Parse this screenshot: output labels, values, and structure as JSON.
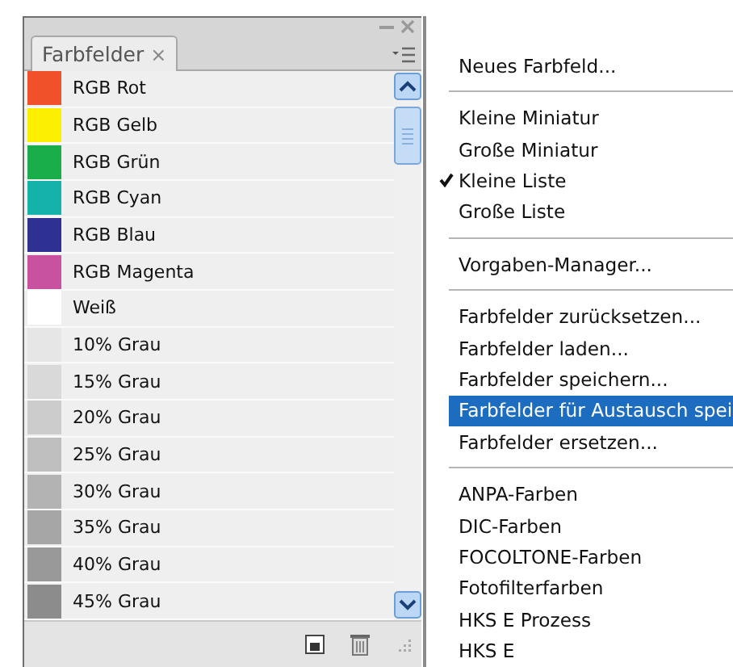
{
  "panel": {
    "tab": {
      "label": "Farbfelder",
      "close": "×"
    },
    "swatches": [
      {
        "name": "RGB Rot",
        "color": "#f0502a"
      },
      {
        "name": "RGB Gelb",
        "color": "#fdef00"
      },
      {
        "name": "RGB Grün",
        "color": "#1aae4a"
      },
      {
        "name": "RGB Cyan",
        "color": "#14b2a8"
      },
      {
        "name": "RGB Blau",
        "color": "#2e3192"
      },
      {
        "name": "RGB Magenta",
        "color": "#c952a0"
      },
      {
        "name": "Weiß",
        "color": "#ffffff"
      },
      {
        "name": "10% Grau",
        "color": "#e6e6e6"
      },
      {
        "name": "15% Grau",
        "color": "#d9d9d9"
      },
      {
        "name": "20% Grau",
        "color": "#cccccc"
      },
      {
        "name": "25% Grau",
        "color": "#bfbfbf"
      },
      {
        "name": "30% Grau",
        "color": "#b3b3b3"
      },
      {
        "name": "35% Grau",
        "color": "#a6a6a6"
      },
      {
        "name": "40% Grau",
        "color": "#999999"
      },
      {
        "name": "45% Grau",
        "color": "#8c8c8c"
      }
    ]
  },
  "menu": {
    "sections": [
      [
        {
          "label": "Neues Farbfeld...",
          "checked": false,
          "selected": false
        }
      ],
      [
        {
          "label": "Kleine Miniatur",
          "checked": false,
          "selected": false
        },
        {
          "label": "Große Miniatur",
          "checked": false,
          "selected": false
        },
        {
          "label": "Kleine Liste",
          "checked": true,
          "selected": false
        },
        {
          "label": "Große Liste",
          "checked": false,
          "selected": false
        }
      ],
      [
        {
          "label": "Vorgaben-Manager...",
          "checked": false,
          "selected": false
        }
      ],
      [
        {
          "label": "Farbfelder zurücksetzen...",
          "checked": false,
          "selected": false
        },
        {
          "label": "Farbfelder laden...",
          "checked": false,
          "selected": false
        },
        {
          "label": "Farbfelder speichern...",
          "checked": false,
          "selected": false
        },
        {
          "label": "Farbfelder für Austausch spei",
          "checked": false,
          "selected": true
        },
        {
          "label": "Farbfelder ersetzen...",
          "checked": false,
          "selected": false
        }
      ],
      [
        {
          "label": "ANPA-Farben",
          "checked": false,
          "selected": false
        },
        {
          "label": "DIC-Farben",
          "checked": false,
          "selected": false
        },
        {
          "label": "FOCOLTONE-Farben",
          "checked": false,
          "selected": false
        },
        {
          "label": "Fotofilterfarben",
          "checked": false,
          "selected": false
        },
        {
          "label": "HKS E Prozess",
          "checked": false,
          "selected": false
        },
        {
          "label": "HKS E",
          "checked": false,
          "selected": false
        }
      ]
    ]
  }
}
